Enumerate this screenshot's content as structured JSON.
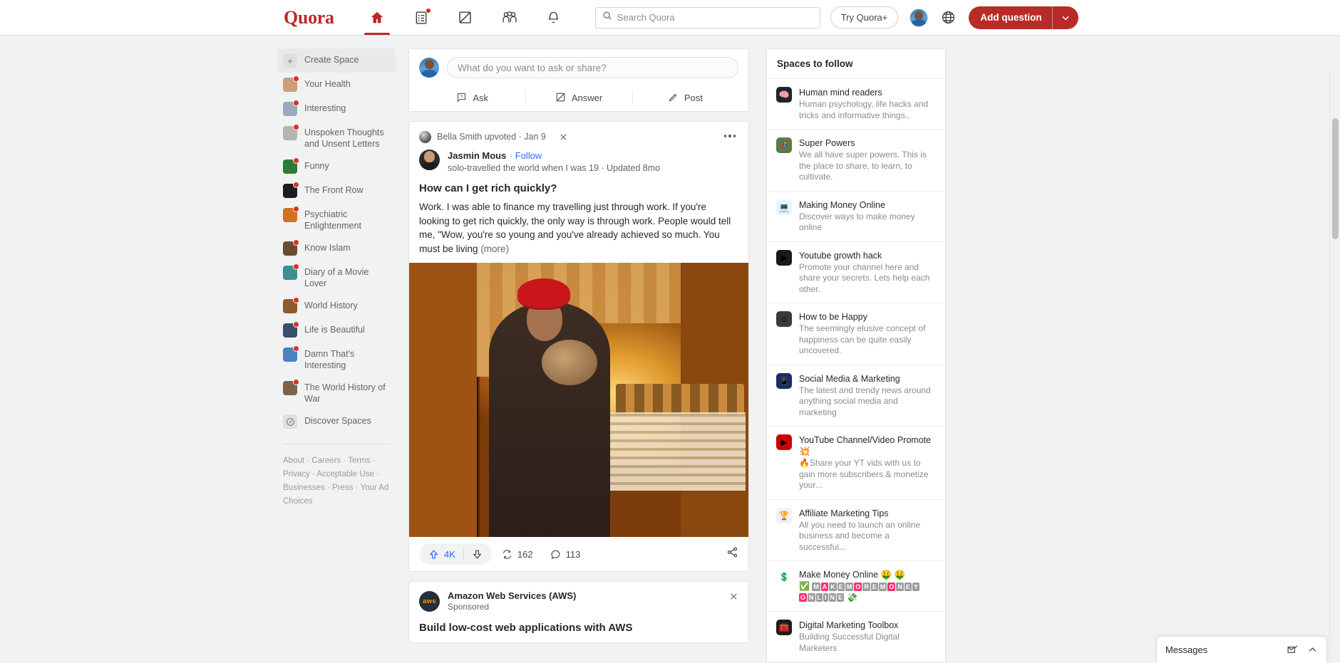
{
  "header": {
    "logo": "Quora",
    "nav": [
      {
        "name": "home",
        "icon": "home-icon",
        "active": true,
        "badge": false
      },
      {
        "name": "answer",
        "icon": "list-icon",
        "active": false,
        "badge": true
      },
      {
        "name": "spaces",
        "icon": "pencil-square-icon",
        "active": false,
        "badge": false
      },
      {
        "name": "people",
        "icon": "people-icon",
        "active": false,
        "badge": false
      },
      {
        "name": "notifications",
        "icon": "bell-icon",
        "active": false,
        "badge": false
      }
    ],
    "search": {
      "placeholder": "Search Quora",
      "value": "",
      "icon": "search-icon"
    },
    "try_plus": "Try Quora+",
    "avatar_icon": "user-avatar",
    "language_icon": "globe-icon",
    "add_question": "Add question",
    "add_question_caret": "chevron-down-icon"
  },
  "sidebar": {
    "create_space": "Create Space",
    "items": [
      {
        "label": "Your Health",
        "color": "#c9a07a",
        "badge": true
      },
      {
        "label": "Interesting",
        "color": "#9aa9bb",
        "badge": true
      },
      {
        "label": "Unspoken Thoughts and Unsent Letters",
        "color": "#b7b3ad",
        "badge": true
      },
      {
        "label": "Funny",
        "color": "#2c7b35",
        "badge": true
      },
      {
        "label": "The Front Row",
        "color": "#1c1c24",
        "badge": true
      },
      {
        "label": "Psychiatric Enlightenment",
        "color": "#d2711e",
        "badge": true
      },
      {
        "label": "Know Islam",
        "color": "#6b4a2e",
        "badge": true
      },
      {
        "label": "Diary of a Movie Lover",
        "color": "#3b8f8c",
        "badge": true
      },
      {
        "label": "World History",
        "color": "#8c5a2b",
        "badge": true
      },
      {
        "label": "Life is Beautiful",
        "color": "#37506b",
        "badge": true
      },
      {
        "label": "Damn That's Interesting",
        "color": "#4a83c4",
        "badge": true
      },
      {
        "label": "The World History of War",
        "color": "#7c6348",
        "badge": true
      }
    ],
    "discover": "Discover Spaces",
    "footer": [
      "About",
      "Careers",
      "Terms",
      "Privacy",
      "Acceptable Use",
      "Businesses",
      "Press",
      "Your Ad Choices"
    ]
  },
  "composer": {
    "placeholder": "What do you want to ask or share?",
    "actions": [
      {
        "label": "Ask",
        "icon": "question-box-icon"
      },
      {
        "label": "Answer",
        "icon": "pencil-square-icon"
      },
      {
        "label": "Post",
        "icon": "pencil-icon"
      }
    ]
  },
  "post": {
    "attribution": "Bella Smith upvoted · Jan 9",
    "close_icon": "close-icon",
    "more_icon": "ellipsis-icon",
    "author": "Jasmin Mous",
    "follow": "· Follow",
    "credential": "solo-travelled the world when I was 19 · Updated 8mo",
    "question": "How can I get rich quickly?",
    "body": "Work. I was able to finance my travelling just through work. If you're looking to get rich quickly, the only way is through work. People would tell me, \"Wow, you're so young and you've already achieved so much. You must be living",
    "more_link": "(more)",
    "upvote_count": "4K",
    "upvote_icon": "upvote-arrow-icon",
    "downvote_icon": "downvote-arrow-icon",
    "reshare_count": "162",
    "reshare_icon": "reshare-icon",
    "comment_count": "113",
    "comment_icon": "comment-bubble-icon",
    "share_icon": "share-icon"
  },
  "ad": {
    "brand": "Amazon Web Services (AWS)",
    "logo_text": "aws",
    "sponsored": "Sponsored",
    "close_icon": "close-icon",
    "headline": "Build low-cost web applications with AWS"
  },
  "right": {
    "title": "Spaces to follow",
    "spaces": [
      {
        "name": "Human mind readers",
        "desc": "Human psychology, life hacks and tricks and informative things..",
        "color": "#1b2430",
        "glyph": "🧠"
      },
      {
        "name": "Super Powers",
        "desc": "We all have super powers. This is the place to share, to learn, to cultivate.",
        "color": "#5e7a4a",
        "glyph": "🦸"
      },
      {
        "name": "Making Money Online",
        "desc": "Discover ways to make money online",
        "color": "#eaf2fb",
        "glyph": "💻"
      },
      {
        "name": "Youtube growth hack",
        "desc": "Promote your channel here and share your secrets. Lets help each other.",
        "color": "#1a1a1a",
        "glyph": "▶"
      },
      {
        "name": "How to be Happy",
        "desc": "The seemingly elusive concept of happiness can be quite easily uncovered.",
        "color": "#3a3a3a",
        "glyph": "☺"
      },
      {
        "name": "Social Media & Marketing",
        "desc": "The latest and trendy news around anything social media and marketing",
        "color": "#1d2a63",
        "glyph": "📱"
      },
      {
        "name": "YouTube Channel/Video Promote 💥",
        "desc": "🔥Share your YT vids with us to gain more subscribers & monetize your...",
        "color": "#cc0000",
        "glyph": "▶"
      },
      {
        "name": "Affiliate Marketing Tips",
        "desc": "All you need to launch an online business and become a successful...",
        "color": "#f2f2f2",
        "glyph": "🏆"
      },
      {
        "name": "Make Money Online 🤑 🤑",
        "desc": "",
        "color": "#ffffff",
        "glyph": "💲",
        "tiles": true
      },
      {
        "name": "Digital Marketing Toolbox",
        "desc": "Building Successful Digital Marketers",
        "color": "#241b17",
        "glyph": "🧰"
      }
    ],
    "make_money_tiles_line1": [
      "M",
      "A",
      "K",
      "E",
      "M",
      "O",
      "R",
      "E",
      "M",
      "O",
      "N",
      "E",
      "Y"
    ],
    "make_money_tiles_line2": [
      "O",
      "N",
      "L",
      "I",
      "N",
      "E"
    ]
  },
  "messages": {
    "label": "Messages",
    "compose_icon": "compose-message-icon",
    "expand_icon": "chevron-up-icon"
  }
}
